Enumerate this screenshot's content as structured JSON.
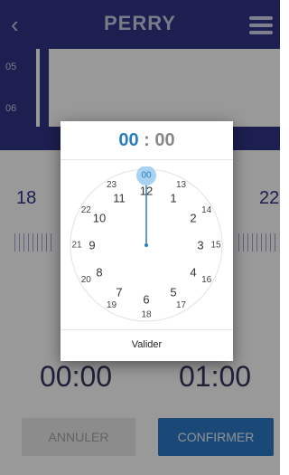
{
  "topbar": {
    "back_icon": "chevron-left-icon",
    "logo": "PERRY",
    "menu_icon": "hamburger-menu-icon"
  },
  "schedule": {
    "hours": [
      "05",
      "06"
    ]
  },
  "temperature": {
    "left": "18",
    "right": "22"
  },
  "times": {
    "start": "00:00",
    "end": "01:00"
  },
  "buttons": {
    "cancel": "ANNULER",
    "confirm": "CONFIRMER"
  },
  "picker": {
    "hour": "00",
    "separator": ":",
    "minute": "00",
    "outer_hours": [
      "12",
      "1",
      "2",
      "3",
      "4",
      "5",
      "6",
      "7",
      "8",
      "9",
      "10",
      "11"
    ],
    "inner_hours": [
      "00",
      "13",
      "14",
      "15",
      "16",
      "17",
      "18",
      "19",
      "20",
      "21",
      "22",
      "23"
    ],
    "selected": "00",
    "action": "Valider"
  },
  "colors": {
    "brand": "#2f3585",
    "accent": "#2a7ec0",
    "confirm": "#2d7bc7"
  }
}
